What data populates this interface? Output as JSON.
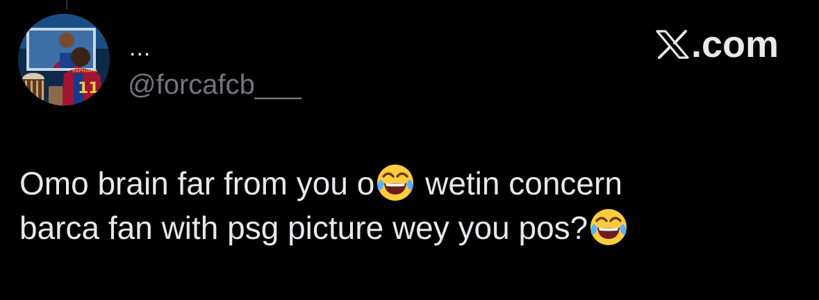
{
  "app": {
    "name": "X",
    "brand_label": ".com",
    "logo_icon": "x-logo-icon"
  },
  "author": {
    "display_name": "...",
    "handle": "@forcafcb___",
    "avatar_icon": "avatar-image"
  },
  "tweet": {
    "line1_part1": "Omo brain far from you o",
    "line1_part2": " wetin concern",
    "line2": "barca fan with psg picture wey you pos?",
    "emoji_icon": "face-with-tears-of-joy-icon"
  },
  "colors": {
    "background": "#000000",
    "primary_text": "#e7e9ea",
    "secondary_text": "#71767b"
  }
}
